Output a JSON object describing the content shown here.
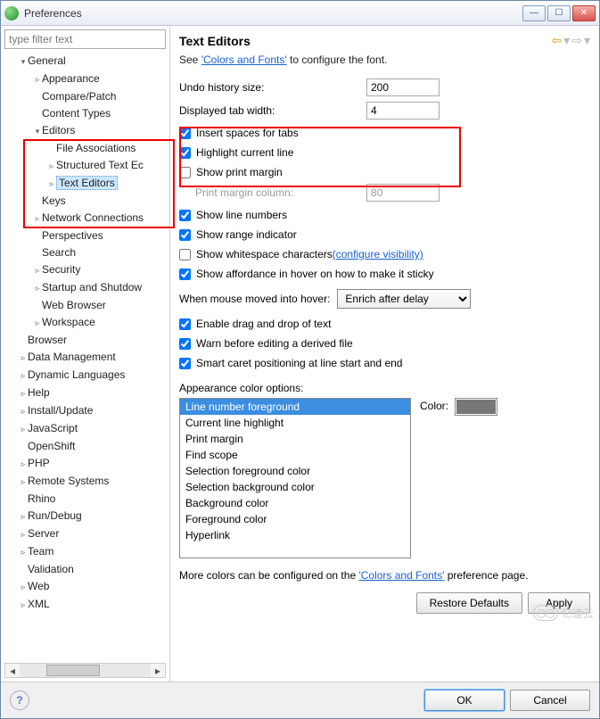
{
  "window": {
    "title": "Preferences"
  },
  "sidebar": {
    "filter_placeholder": "type filter text",
    "tree": {
      "general": "General",
      "appearance": "Appearance",
      "compare": "Compare/Patch",
      "contenttypes": "Content Types",
      "editors": "Editors",
      "fileassoc": "File Associations",
      "structured": "Structured Text Ec",
      "texteditors": "Text Editors",
      "keys": "Keys",
      "network": "Network Connections",
      "perspectives": "Perspectives",
      "search": "Search",
      "security": "Security",
      "startup": "Startup and Shutdow",
      "webbrowser": "Web Browser",
      "workspace": "Workspace",
      "browser": "Browser",
      "datamgmt": "Data Management",
      "dynlang": "Dynamic Languages",
      "help": "Help",
      "install": "Install/Update",
      "javascript": "JavaScript",
      "openshift": "OpenShift",
      "php": "PHP",
      "remote": "Remote Systems",
      "rhino": "Rhino",
      "rundebug": "Run/Debug",
      "server": "Server",
      "team": "Team",
      "validation": "Validation",
      "web": "Web",
      "xml": "XML"
    }
  },
  "page": {
    "title": "Text Editors",
    "intro_pre": "See ",
    "intro_link": "'Colors and Fonts'",
    "intro_post": " to configure the font.",
    "undo_label": "Undo history size:",
    "undo_value": "200",
    "tabw_label": "Displayed tab width:",
    "tabw_value": "4",
    "chk_spaces": "Insert spaces for tabs",
    "chk_highlight": "Highlight current line",
    "chk_printmargin": "Show print margin",
    "printcol_label": "Print margin column:",
    "printcol_value": "80",
    "chk_linenum": "Show line numbers",
    "chk_range": "Show range indicator",
    "chk_whitespace": "Show whitespace characters ",
    "whitespace_link": "(configure visibility)",
    "chk_affordance": "Show affordance in hover on how to make it sticky",
    "hover_label": "When mouse moved into hover:",
    "hover_value": "Enrich after delay",
    "chk_dnd": "Enable drag and drop of text",
    "chk_warn": "Warn before editing a derived file",
    "chk_caret": "Smart caret positioning at line start and end",
    "color_label": "Appearance color options:",
    "color_btn": "Color:",
    "listbox": [
      "Line number foreground",
      "Current line highlight",
      "Print margin",
      "Find scope",
      "Selection foreground color",
      "Selection background color",
      "Background color",
      "Foreground color",
      "Hyperlink"
    ],
    "more_pre": "More colors can be configured on the ",
    "more_link": "'Colors and Fonts'",
    "more_post": " preference page.",
    "restore": "Restore Defaults",
    "apply": "Apply"
  },
  "footer": {
    "ok": "OK",
    "cancel": "Cancel"
  },
  "watermark": "亿速云"
}
